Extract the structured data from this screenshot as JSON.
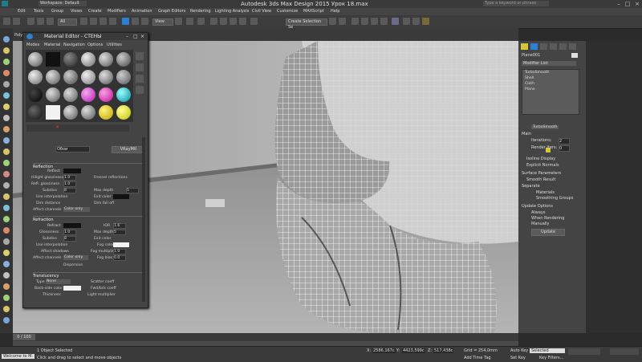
{
  "window": {
    "workspace": "Workspace: Default",
    "title": "Autodesk 3ds Max Design 2015   Урок 18.max",
    "search_placeholder": "Type a keyword or phrase"
  },
  "menu": [
    "Edit",
    "Tools",
    "Group",
    "Views",
    "Create",
    "Modifiers",
    "Animation",
    "Graph Editors",
    "Rendering",
    "Lighting Analysis",
    "Civil View",
    "Customize",
    "MAXScript",
    "Help"
  ],
  "toolbar": {
    "selection_filter": "All",
    "view_dropdown": "View",
    "create_selection_set": "Create Selection Se",
    "ribbon_label": "Polygon"
  },
  "material_editor": {
    "title": "Material Editor - СТЕНЫ",
    "menu": [
      "Modes",
      "Material",
      "Navigation",
      "Options",
      "Utilities"
    ],
    "name_field": "Обои",
    "type_button": "VRayMtl",
    "rollouts": {
      "reflection": {
        "header": "Reflection",
        "reflect": "Reflect",
        "hilight_glossiness": "Hilight glossiness",
        "refl_glossiness": "Refl. glossiness",
        "subdivs": "Subdivs",
        "use_interpolation": "Use interpolation",
        "dim_distance": "Dim distance",
        "affect_channels": "Affect channels",
        "affect_channels_value": "Color only",
        "fresnel": "Fresnel reflections",
        "max_depth": "Max depth",
        "exit_color": "Exit color",
        "dim_falloff": "Dim fall off",
        "values": {
          "hilight": "1.0",
          "refl": "1.0",
          "subdivs": "8",
          "max_depth": "5"
        }
      },
      "refraction": {
        "header": "Refraction",
        "refract": "Refract",
        "glossiness": "Glossiness",
        "subdivs": "Subdivs",
        "use_interpolation": "Use interpolation",
        "affect_shadows": "Affect shadows",
        "affect_channels": "Affect channels",
        "affect_channels_value": "Color only",
        "ior": "IOR",
        "max_depth": "Max depth",
        "exit_color": "Exit color",
        "fog_color": "Fog color",
        "fog_multiplier": "Fog multiplier",
        "fog_bias": "Fog bias",
        "dispersion": "Dispersion",
        "values": {
          "ior": "1.6",
          "glossiness": "1.0",
          "subdivs": "8",
          "max_depth": "5",
          "fog_multiplier": "1.0",
          "fog_bias": "0.0"
        }
      },
      "translucency": {
        "header": "Translucency",
        "type": "Type",
        "type_value": "None",
        "back_side_color": "Back-side color",
        "thickness": "Thickness",
        "scatter_coeff": "Scatter coeff",
        "fwd_bck_coeff": "Fwd/bck coeff",
        "light_multiplier": "Light multiplier"
      }
    }
  },
  "command_panel": {
    "object_name": "Plane001",
    "modifier_list": "Modifier List",
    "stack": [
      "TurboSmooth",
      "Shell",
      "Cloth",
      "Plane"
    ],
    "turbosmooth": {
      "header": "TurboSmooth",
      "main": "Main",
      "iterations": "Iterations:",
      "iterations_value": "2",
      "render_iters": "Render Iters:",
      "render_iters_value": "0",
      "isoline_display": "Isoline Display",
      "explicit_normals": "Explicit Normals",
      "surface_parameters": "Surface Parameters",
      "smooth_result": "Smooth Result",
      "separate": "Separate",
      "materials": "Materials",
      "smoothing_groups": "Smoothing Groups",
      "update_options": "Update Options",
      "always": "Always",
      "when_rendering": "When Rendering",
      "manually": "Manually",
      "update_button": "Update"
    }
  },
  "timeline": {
    "frame_label": "0 / 100"
  },
  "statusbar": {
    "welcome": "Welcome to M:",
    "status": "1 Object Selected",
    "prompt": "Click and drag to select and move objects",
    "x_label": "X:",
    "x": "2586,167c",
    "y_label": "Y:",
    "y": "4423,599c",
    "z_label": "Z:",
    "z": "517,438c",
    "grid": "Grid = 254,0mm",
    "add_time_tag": "Add Time Tag",
    "auto_key": "Auto Key",
    "set_key": "Set Key",
    "selected": "Selected",
    "key_filters": "Key Filters..."
  },
  "colors": {
    "accent": "#d6c43a",
    "panel": "#444444",
    "viewport_bg": "#7c7c7c"
  }
}
